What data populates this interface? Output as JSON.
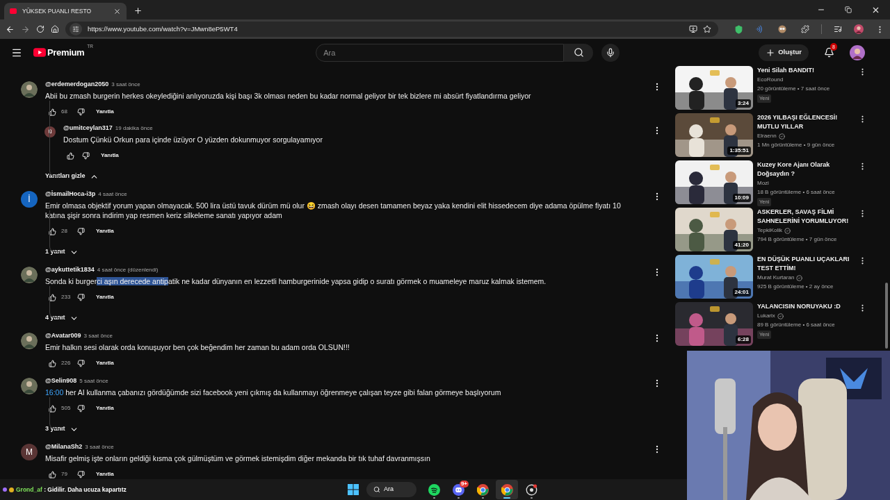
{
  "browser": {
    "tab": {
      "title": "YÜKSEK PUANLI RESTO"
    },
    "url": "https://www.youtube.com/watch?v=JMwn8eP5WT4"
  },
  "header": {
    "logo": "Premium",
    "region": "TR",
    "search_placeholder": "Ara",
    "create_label": "Oluştur",
    "notification_count": "8"
  },
  "threads": [
    {
      "comment": {
        "author": "@erdemerdogan2050",
        "time": "3 saat önce",
        "body": [
          {
            "kind": "text",
            "text": "Abii bu zmash burgerin herkes okeylediğini anlıyoruzda kişi başı 3k olması neden bu kadar normal geliyor bir tek bizlere mi absürt fiyatlandırma geliyor"
          }
        ],
        "likes": "68",
        "reply_label": "Yanıtla"
      },
      "replies": [
        {
          "author": "@umitceylan317",
          "time": "19 dakika önce",
          "avatar": {
            "kind": "letter",
            "letter": "ü",
            "color": "#6e3b3b"
          },
          "body": [
            {
              "kind": "text",
              "text": "Dostum Çünkü Orkun para içinde üzüyor O yüzden dokunmuyor sorgulayamıyor"
            }
          ],
          "reply_label": "Yanıtla"
        }
      ],
      "toggle": {
        "label": "Yanıtları gizle",
        "expanded": true
      }
    },
    {
      "comment": {
        "author": "@İsmailHoca-i3p",
        "time": "4 saat önce",
        "avatar": {
          "kind": "letter",
          "letter": "İ",
          "color": "#1565c0"
        },
        "body": [
          {
            "kind": "text",
            "text": "Emir olmasa objektif yorum yapan olmayacak. 500 lira üstü tavuk dürüm mü olur 😆  zmash olayı desen tamamen beyaz yaka kendini elit hissedecem diye adama öpülme fiyatı 10 katına şişir sonra indirim yap resmen keriz silkeleme sanatı yapıyor adam"
          }
        ],
        "likes": "28",
        "reply_label": "Yanıtla"
      },
      "toggle": {
        "label": "1 yanıt",
        "expanded": false
      }
    },
    {
      "comment": {
        "author": "@aykuttetik1834",
        "time": "4 saat önce (düzenlendi)",
        "body": [
          {
            "kind": "text",
            "text": "Sonda ki burger"
          },
          {
            "kind": "selection",
            "text": "ci aşın derecede antip"
          },
          {
            "kind": "text",
            "text": "atik ne kadar dünyanın en lezzetli hamburgerinide yapsa gidip o suratı görmek o muameleye maruz kalmak istemem."
          }
        ],
        "likes": "233",
        "reply_label": "Yanıtla"
      },
      "toggle": {
        "label": "4 yanıt",
        "expanded": false
      }
    },
    {
      "comment": {
        "author": "@Avatar009",
        "time": "3 saat önce",
        "body": [
          {
            "kind": "text",
            "text": "Emir halkın sesi olarak orda konuşuyor ben çok beğendim her zaman bu adam orda  OLSUN!!!"
          }
        ],
        "likes": "226",
        "reply_label": "Yanıtla"
      }
    },
    {
      "comment": {
        "author": "@Selin908",
        "time": "5 saat önce",
        "body": [
          {
            "kind": "link",
            "text": "16:00"
          },
          {
            "kind": "text",
            "text": " her AI kullanma çabanızı gördüğümde sizi facebook yeni çıkmış da kullanmayı öğrenmeye çalışan teyze gibi falan görmeye başlıyorum"
          }
        ],
        "likes": "505",
        "reply_label": "Yanıtla"
      },
      "toggle": {
        "label": "3 yanıt",
        "expanded": false
      }
    },
    {
      "comment": {
        "author": "@MilanaSh2",
        "time": "3 saat önce",
        "avatar": {
          "kind": "letter",
          "letter": "M",
          "color": "#5a3535"
        },
        "body": [
          {
            "kind": "text",
            "text": "Misafir gelmiş işte onların geldiği kısma çok gülmüştüm ve görmek istemişdim diğer mekanda bir tık tuhaf davranmışsın"
          }
        ],
        "likes": "79",
        "reply_label": "Yanıtla"
      }
    }
  ],
  "videos": [
    {
      "title": "Yeni Silah BANDIT!",
      "channel": "EcoRound",
      "verified": false,
      "stats": "20 görüntüleme • 7 saat önce",
      "duration": "3:24",
      "badge": "Yeni"
    },
    {
      "title": "2026 YILBAŞI EĞLENCESİ! MUTLU YILLAR",
      "channel": "Elraenn",
      "verified": true,
      "stats": "1 Mn görüntüleme • 9 gün önce",
      "duration": "1:35:51"
    },
    {
      "title": "Kuzey Kore Ajanı Olarak Doğsaydın ?",
      "channel": "Mozi",
      "verified": false,
      "stats": "18 B görüntüleme • 6 saat önce",
      "duration": "10:09",
      "badge": "Yeni"
    },
    {
      "title": "ASKERLER, SAVAŞ FİLMİ SAHNELERİNİ YORUMLUYOR!",
      "channel": "TepkiKolik",
      "verified": true,
      "stats": "794 B görüntüleme • 7 gün önce",
      "duration": "41:20"
    },
    {
      "title": "EN DÜŞÜK PUANLI UÇAKLARI TEST ETTİM!",
      "channel": "Murat Kurtaran",
      "verified": true,
      "stats": "925 B görüntüleme • 2 ay önce",
      "duration": "24:01"
    },
    {
      "title": "YALANCISIN NORUYAKU :D",
      "channel": "Lukarix",
      "verified": true,
      "stats": "89 B görüntüleme • 6 saat önce",
      "duration": "6:28",
      "badge": "Yeni"
    }
  ],
  "chat_overlay": {
    "user": "Grond_af",
    "message": ": Gidilir. Daha ucuza kapartıtz"
  },
  "taskbar": {
    "search_label": "Ara",
    "apps": [
      {
        "kind": "spotify",
        "active": false
      },
      {
        "kind": "discord",
        "active": false,
        "badge": "9+"
      },
      {
        "kind": "chrome",
        "active": false
      },
      {
        "kind": "chrome",
        "active": true
      },
      {
        "kind": "recorder",
        "active": false
      }
    ]
  }
}
